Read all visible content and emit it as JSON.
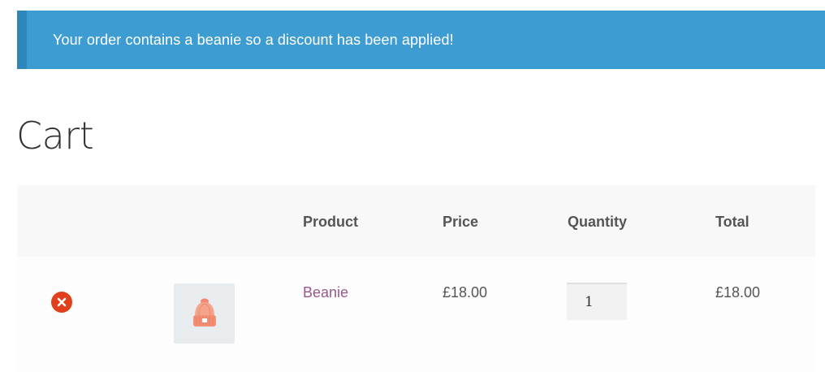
{
  "notice": {
    "message": "Your order contains a beanie so a discount has been applied!",
    "background_color": "#3d9cd2"
  },
  "page": {
    "title": "Cart"
  },
  "cart_table": {
    "headers": {
      "product": "Product",
      "price": "Price",
      "quantity": "Quantity",
      "total": "Total"
    },
    "rows": [
      {
        "remove_icon": "remove-circle-x-icon",
        "thumbnail_icon": "beanie-hat-icon",
        "product": "Beanie",
        "price": "£18.00",
        "quantity": "1",
        "total": "£18.00"
      }
    ]
  },
  "colors": {
    "link": "#96588a",
    "remove": "#e2401c",
    "notice_border": "#2f86bb"
  }
}
